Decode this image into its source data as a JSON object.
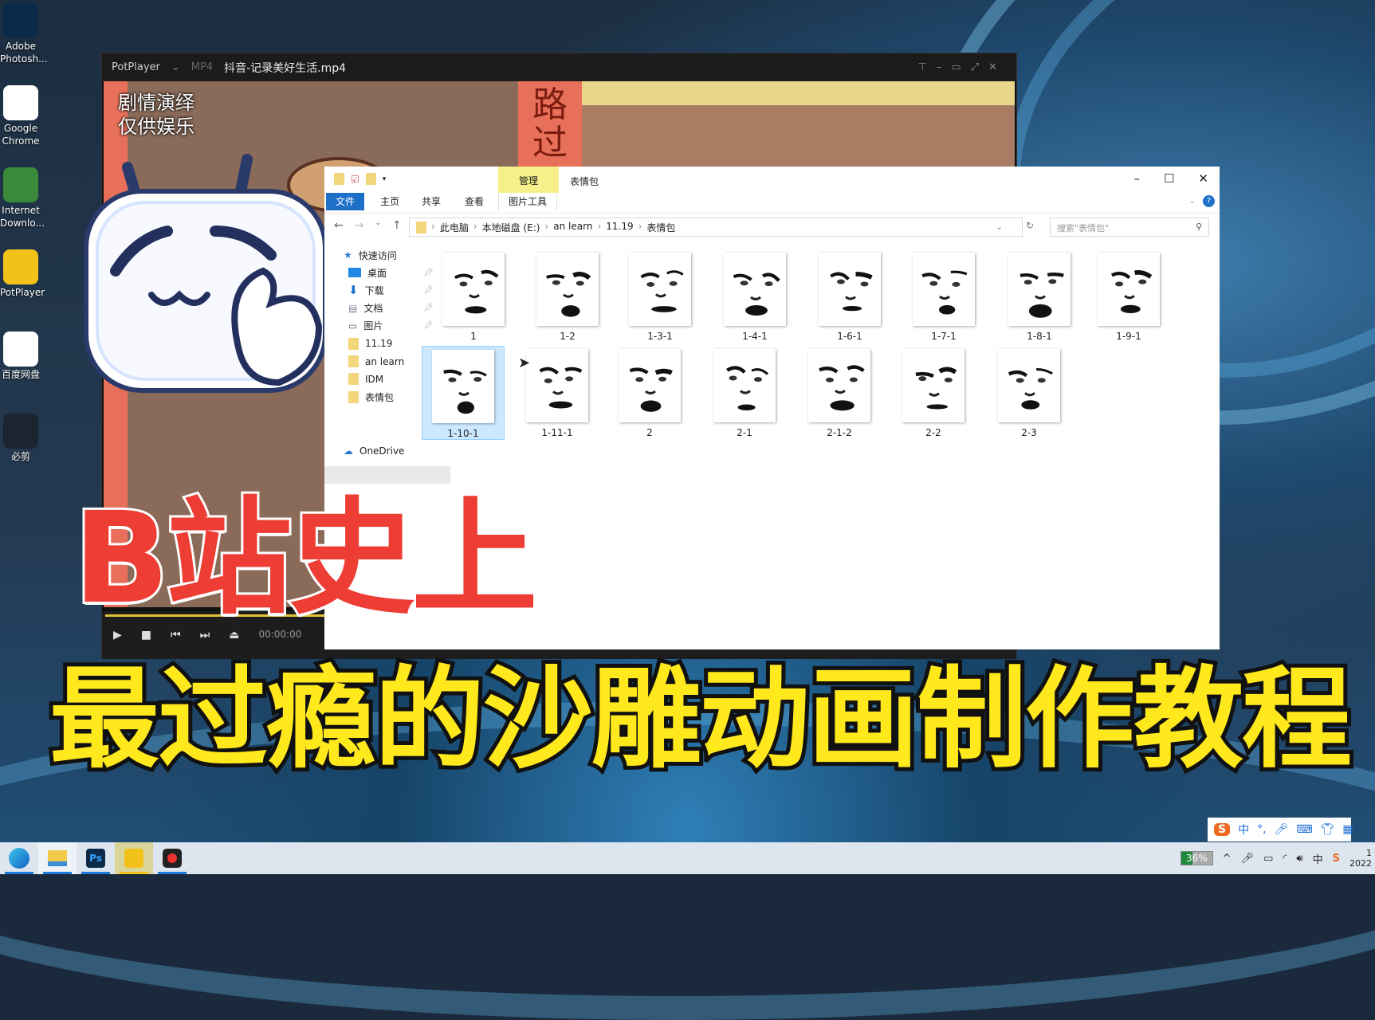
{
  "desktop_icons": [
    {
      "label": "Adobe Photosh...",
      "icon": "photoshop-icon"
    },
    {
      "label": "Google Chrome",
      "icon": "chrome-icon"
    },
    {
      "label": "Internet Downlo...",
      "icon": "idm-icon"
    },
    {
      "label": "PotPlayer",
      "icon": "potplayer-icon"
    },
    {
      "label": "百度网盘",
      "icon": "baidu-netdisk-icon"
    },
    {
      "label": "必剪",
      "icon": "bijian-icon"
    }
  ],
  "player": {
    "app": "PotPlayer",
    "format": "MP4",
    "file": "抖音-记录美好生活.mp4",
    "overlay_line1": "剧情演绎",
    "overlay_line2": "仅供娱乐",
    "sign": "路过",
    "time": "00:00:00",
    "progress": 0
  },
  "explorer": {
    "title": "表情包",
    "contextual_tab": "管理",
    "tabs": [
      "文件",
      "主页",
      "共享",
      "查看",
      "图片工具"
    ],
    "breadcrumb": [
      "此电脑",
      "本地磁盘 (E:)",
      "an learn",
      "11.19",
      "表情包"
    ],
    "search_placeholder": "搜索\"表情包\"",
    "nav": {
      "quick_access": "快速访问",
      "items": [
        {
          "label": "桌面",
          "pinned": true
        },
        {
          "label": "下载",
          "pinned": true
        },
        {
          "label": "文档",
          "pinned": true
        },
        {
          "label": "图片",
          "pinned": true
        },
        {
          "label": "11.19"
        },
        {
          "label": "an learn"
        },
        {
          "label": "IDM"
        },
        {
          "label": "表情包"
        }
      ],
      "onedrive": "OneDrive"
    },
    "files": [
      "1",
      "1-2",
      "1-3-1",
      "1-4-1",
      "1-6-1",
      "1-7-1",
      "1-8-1",
      "1-9-1",
      "1-10-1",
      "1-11-1",
      "2",
      "2-1",
      "2-1-2",
      "2-2",
      "2-3"
    ],
    "selected": "1-10-1"
  },
  "overlay": {
    "headline1": "B站史上",
    "headline2": "最过瘾的沙雕动画制作教程"
  },
  "ime": {
    "mode": "中",
    "punct": "°,"
  },
  "tray": {
    "battery": "36%",
    "lang": "中",
    "time": "1",
    "date": "2022"
  },
  "colors": {
    "red": "#ee3d34",
    "yellow": "#ffe81c",
    "accent": "#1e6fc8"
  }
}
